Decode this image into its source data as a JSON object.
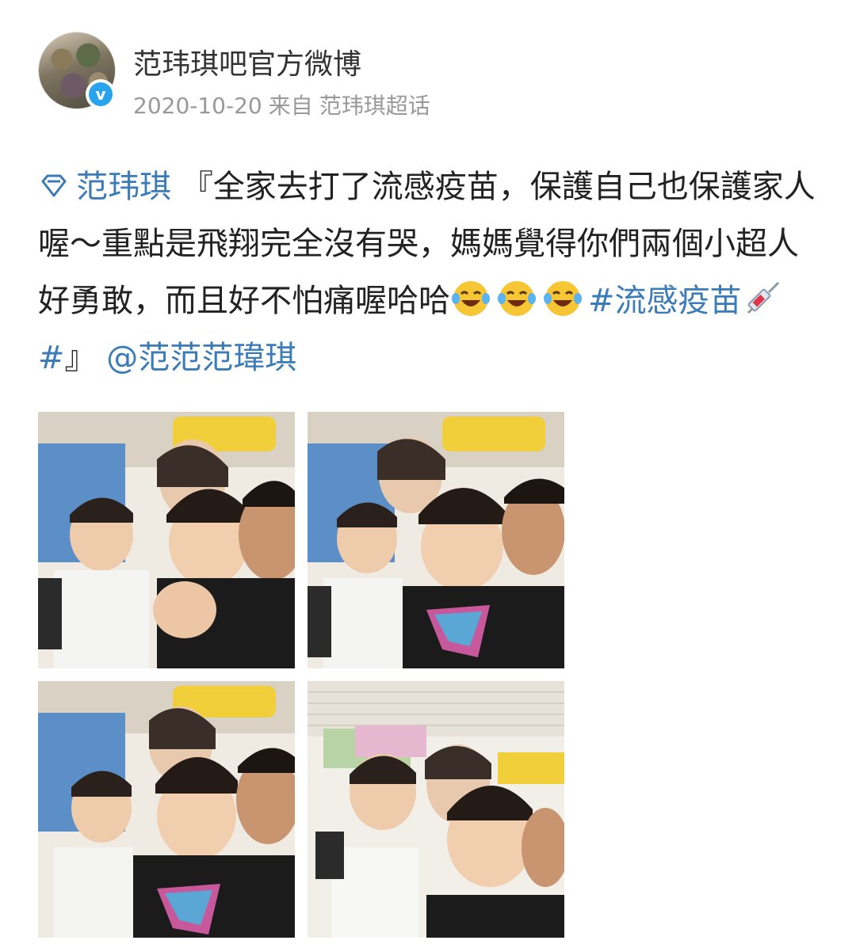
{
  "post": {
    "author": "范玮琪吧官方微博",
    "date": "2020-10-20",
    "source_prefix": "来自",
    "source": "范玮琪超话",
    "topic_link": "范玮琪",
    "text_main": "『全家去打了流感疫苗，保護自己也保護家人喔～重點是飛翔完全沒有哭，媽媽覺得你們兩個小超人好勇敢，而且好不怕痛喔哈哈",
    "hashtag": "#流感疫苗",
    "hashtag_end": "#",
    "close_quote": "』",
    "mention": "@范范范瑋琪",
    "emojis": [
      "laughing-crying-emoji",
      "laughing-crying-emoji",
      "laughing-crying-emoji"
    ],
    "photo_count": 4
  },
  "colors": {
    "link": "#3b7bb8",
    "meta": "#999999",
    "verified": "#2aa3ee"
  }
}
